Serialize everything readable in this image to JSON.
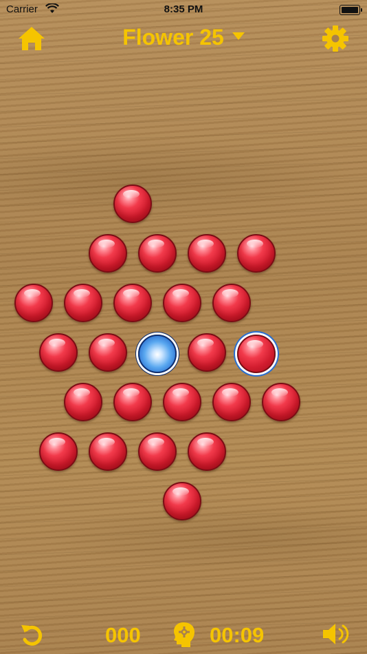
{
  "status_bar": {
    "carrier": "Carrier",
    "time": "8:35 PM"
  },
  "header": {
    "title": "Flower 25"
  },
  "footer": {
    "moves": "000",
    "timer": "00:09"
  },
  "colors": {
    "accent": "#f5c400",
    "peg_red": "#d21d2f",
    "peg_blue": "#5aa8f0"
  },
  "icons": [
    "home-icon",
    "gear-icon",
    "undo-icon",
    "hint-head-icon",
    "speaker-icon",
    "wifi-icon",
    "battery-icon"
  ],
  "board": {
    "rows": [
      [
        "red"
      ],
      [
        "red",
        "red",
        "red",
        "red"
      ],
      [
        "red",
        "red",
        "red",
        "red",
        "red"
      ],
      [
        "red",
        "red",
        "empty",
        "red",
        "selected"
      ],
      [
        "red",
        "red",
        "red",
        "red",
        "red"
      ],
      [
        "red",
        "red",
        "red",
        "red"
      ],
      [
        "red"
      ]
    ]
  }
}
